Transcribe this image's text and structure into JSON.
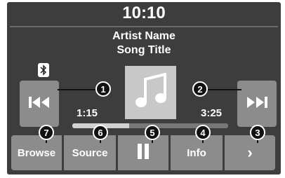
{
  "status": {
    "clock": "10:10"
  },
  "track": {
    "artist": "Artist Name",
    "title": "Song Title"
  },
  "playback": {
    "elapsed": "1:15",
    "duration": "3:25",
    "progress": 0.366
  },
  "bottom_bar": {
    "browse_label": "Browse",
    "source_label": "Source",
    "pause_icon": "pause-icon",
    "info_label": "Info",
    "more_label": "›"
  },
  "callouts": [
    "1",
    "2",
    "3",
    "4",
    "5",
    "6",
    "7"
  ],
  "icons": {
    "bluetooth": "bluetooth-icon",
    "previous": "skip-previous-icon",
    "next": "skip-next-icon",
    "album_art": "music-note-icon"
  },
  "colors": {
    "screen": "#3d3d3d",
    "button": "#8c8c8c",
    "album_art_bg": "#c8c8c8",
    "text": "#ffffff",
    "callout": "#111111"
  }
}
